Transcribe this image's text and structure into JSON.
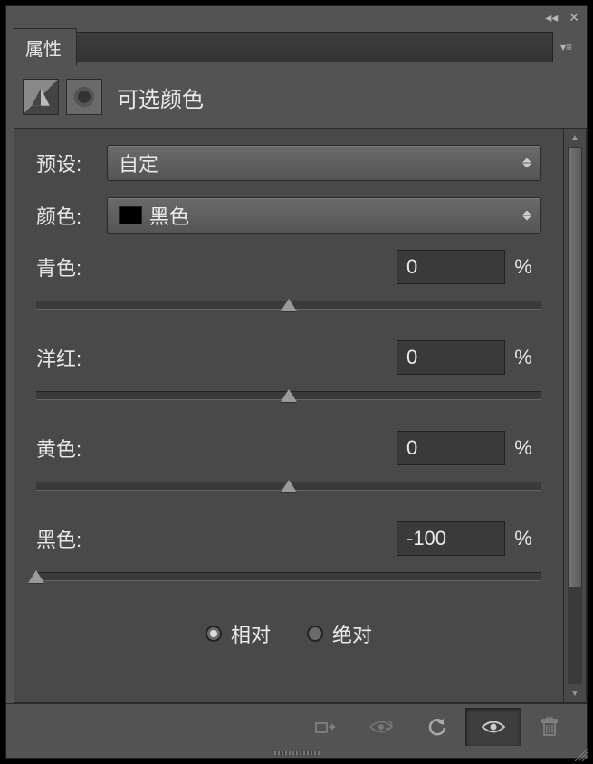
{
  "tab": {
    "label": "属性"
  },
  "header": {
    "title": "可选颜色"
  },
  "preset": {
    "label": "预设:",
    "value": "自定"
  },
  "color": {
    "label": "颜色:",
    "value": "黑色"
  },
  "sliders": {
    "cyan": {
      "label": "青色:",
      "value": "0",
      "pct": "%",
      "pos": 50
    },
    "magenta": {
      "label": "洋红:",
      "value": "0",
      "pct": "%",
      "pos": 50
    },
    "yellow": {
      "label": "黄色:",
      "value": "0",
      "pct": "%",
      "pos": 50
    },
    "black": {
      "label": "黑色:",
      "value": "-100",
      "pct": "%",
      "pos": 0
    }
  },
  "method": {
    "relative": "相对",
    "absolute": "绝对",
    "selected": "relative"
  }
}
